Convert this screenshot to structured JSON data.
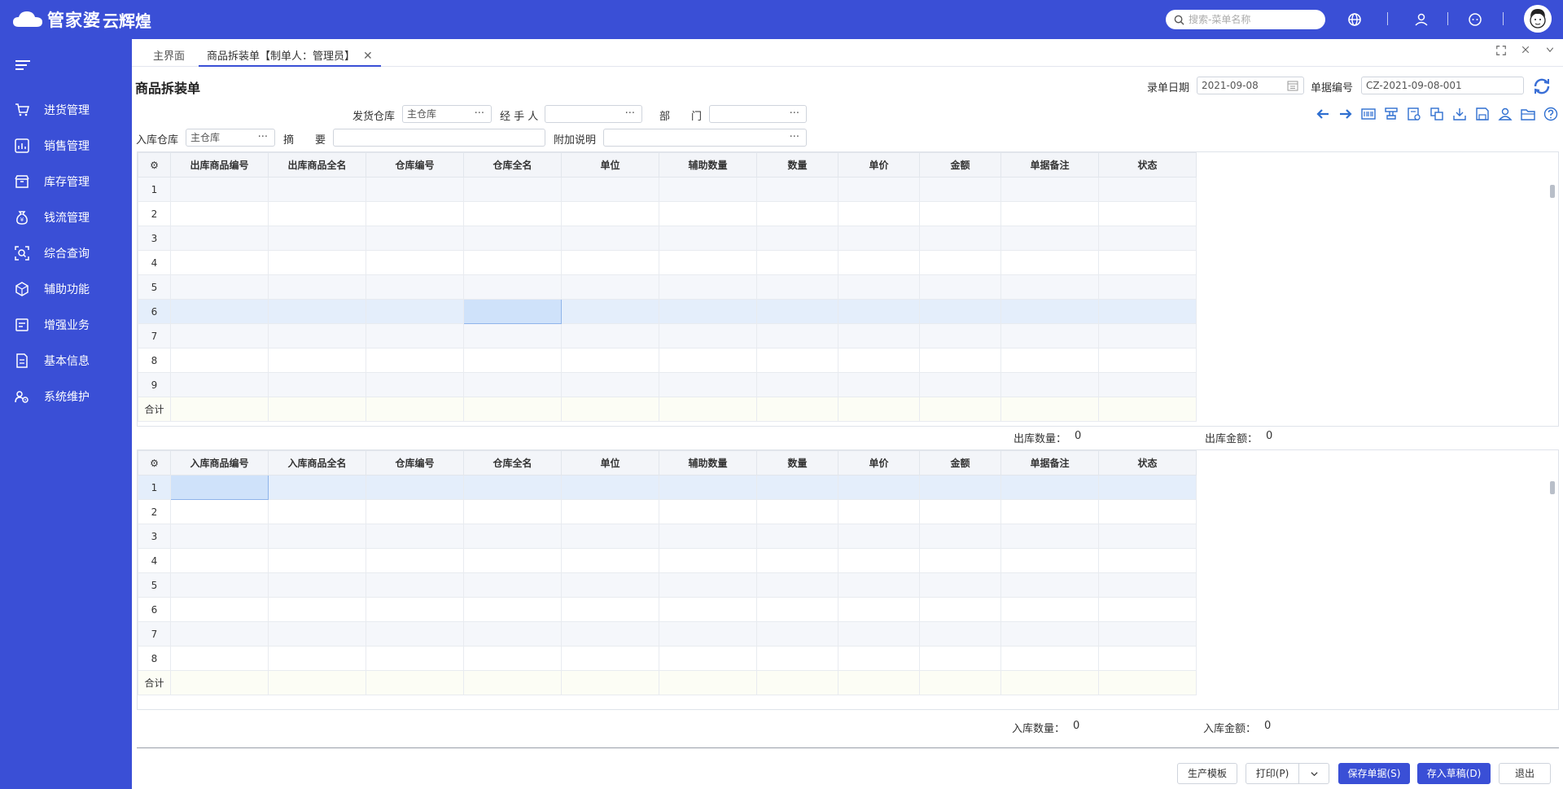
{
  "app": {
    "brand": "管家婆",
    "product": "云辉煌",
    "search_placeholder": "搜索-菜单名称",
    "colors": {
      "primary": "#3a4fd6",
      "sidebar": "#3a4fd6",
      "selected_row": "#e4eefb"
    }
  },
  "sidebar": {
    "items": [
      {
        "label": "进货管理",
        "icon": "cart-icon"
      },
      {
        "label": "销售管理",
        "icon": "sales-chart-icon"
      },
      {
        "label": "库存管理",
        "icon": "box-icon"
      },
      {
        "label": "钱流管理",
        "icon": "money-bag-icon"
      },
      {
        "label": "综合查询",
        "icon": "query-icon"
      },
      {
        "label": "辅助功能",
        "icon": "cube-icon"
      },
      {
        "label": "增强业务",
        "icon": "calendar-icon"
      },
      {
        "label": "基本信息",
        "icon": "document-icon"
      },
      {
        "label": "系统维护",
        "icon": "users-gear-icon"
      }
    ]
  },
  "tabs": [
    {
      "label": "主界面"
    },
    {
      "label": "商品拆装单【制单人：管理员】",
      "close": "✕"
    }
  ],
  "form": {
    "title": "商品拆装单",
    "date_label": "录单日期",
    "date_value": "2021-09-08",
    "number_label": "单据编号",
    "number_value": "CZ-2021-09-08-001",
    "ship_wh_label": "发货仓库",
    "ship_wh_value": "主仓库",
    "handler_label": "经 手 人",
    "handler_value": "",
    "dept_label": "部　　门",
    "dept_value": "",
    "in_wh_label": "入库仓库",
    "in_wh_value": "主仓库",
    "summary_label": "摘　　要",
    "summary_value": "",
    "note_label": "附加说明",
    "note_value": "",
    "dots": "···"
  },
  "grid_out": {
    "columns": [
      "出库商品编号",
      "出库商品全名",
      "仓库编号",
      "仓库全名",
      "单位",
      "辅助数量",
      "数量",
      "单价",
      "金额",
      "单据备注",
      "状态"
    ],
    "rows": [
      "1",
      "2",
      "3",
      "4",
      "5",
      "6",
      "7",
      "8",
      "9"
    ],
    "sum_label": "合计"
  },
  "totals_out": {
    "qty_label": "出库数量：",
    "qty_value": "0",
    "amount_label": "出库金额：",
    "amount_value": "0"
  },
  "grid_in": {
    "columns": [
      "入库商品编号",
      "入库商品全名",
      "仓库编号",
      "仓库全名",
      "单位",
      "辅助数量",
      "数量",
      "单价",
      "金额",
      "单据备注",
      "状态"
    ],
    "rows": [
      "1",
      "2",
      "3",
      "4",
      "5",
      "6",
      "7",
      "8"
    ],
    "sum_label": "合计"
  },
  "totals_in": {
    "qty_label": "入库数量：",
    "qty_value": "0",
    "amount_label": "入库金额：",
    "amount_value": "0"
  },
  "buttons": {
    "template": "生产模板",
    "print": "打印(P)",
    "save": "保存单据(S)",
    "draft": "存入草稿(D)",
    "exit": "退出"
  }
}
